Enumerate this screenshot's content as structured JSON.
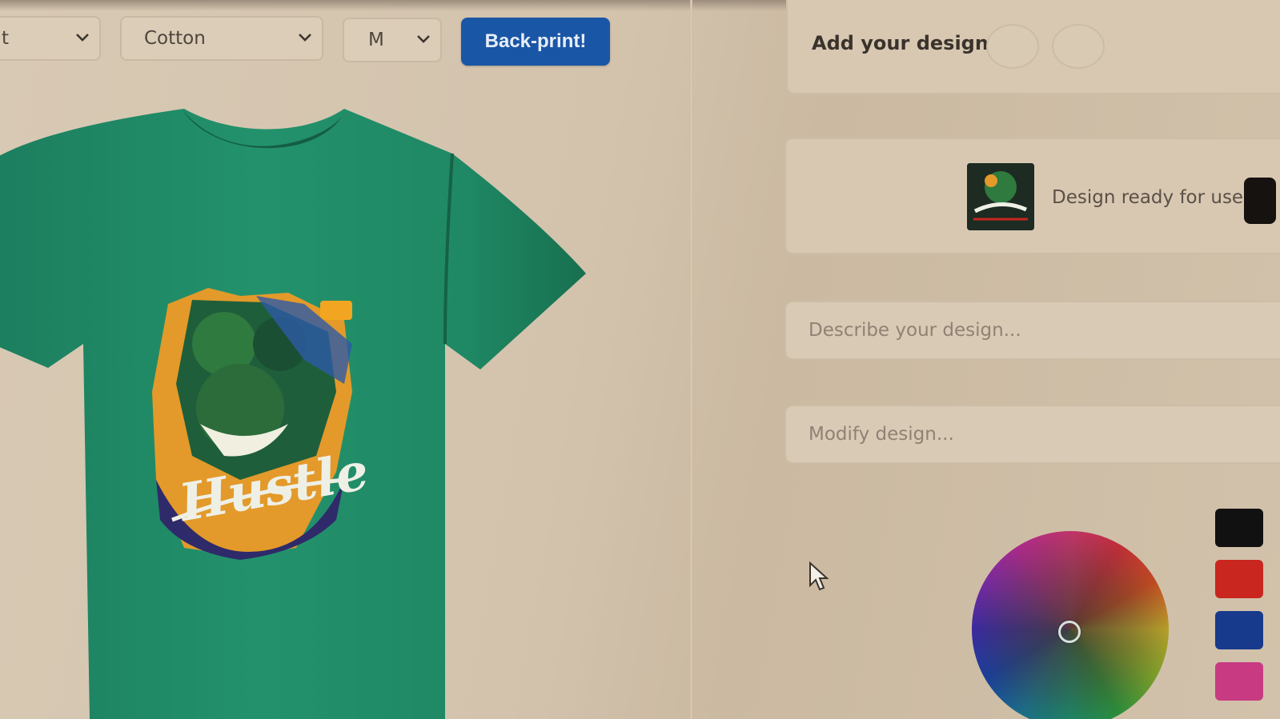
{
  "toolbar": {
    "type_select": {
      "value": "t"
    },
    "material_select": {
      "value": "Cotton"
    },
    "size_select": {
      "value": "M"
    },
    "back_print_label": "Back-print!"
  },
  "colors": {
    "accent": "#1a56a6",
    "shirt": "#1f8a66"
  },
  "preview": {
    "graphic_text": "Hustle"
  },
  "design_panel": {
    "add_title": "Add your design",
    "ready_text": "Design ready for use",
    "describe_placeholder": "Describe your design...",
    "modify_placeholder": "Modify design..."
  },
  "swatches": [
    "#111111",
    "#c8261f",
    "#183a8c",
    "#c83a82"
  ],
  "icons": [
    "chevron-down-icon",
    "mouse-pointer-icon",
    "color-wheel"
  ]
}
